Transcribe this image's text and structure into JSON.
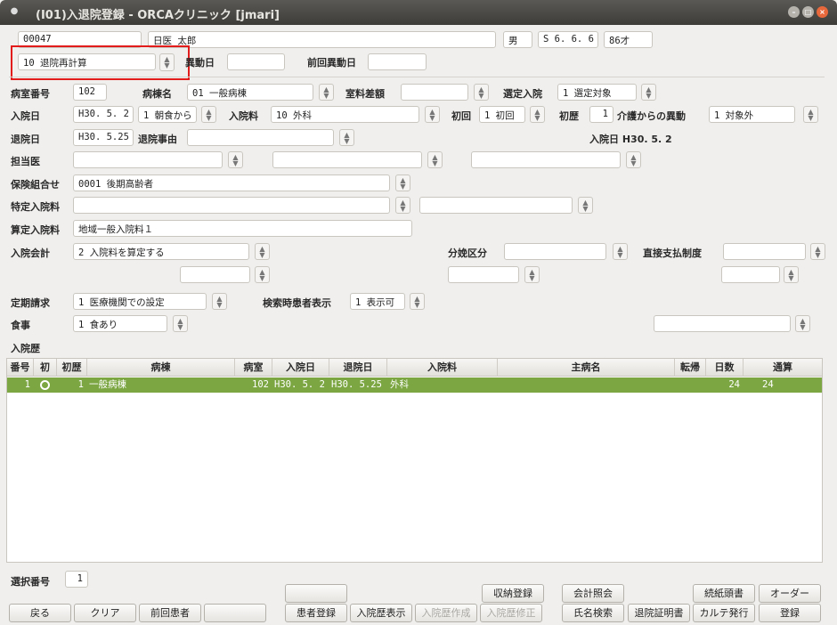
{
  "window": {
    "title": "(I01)入退院登録 - ORCAクリニック [jmari]"
  },
  "patient": {
    "id": "00047",
    "name": "日医  太郎",
    "sex": "男",
    "birthdate": "S 6. 6. 6",
    "age": "86才"
  },
  "mode_select": {
    "value": "10 退院再計算"
  },
  "labels": {
    "ido_date": "異動日",
    "prev_ido_date": "前回異動日",
    "room_no": "病室番号",
    "ward_name": "病棟名",
    "room_diff": "室料差額",
    "selected_admission": "選定入院",
    "admission_date": "入院日",
    "admission_dept": "入院料",
    "first_time": "初回",
    "first_history": "初歴",
    "care_transfer": "介護からの異動",
    "discharge_date": "退院日",
    "discharge_reason": "退院事由",
    "doctor": "担当医",
    "insurance_combo": "保険組合せ",
    "special_fee": "特定入院料",
    "calc_fee": "算定入院料",
    "admission_account": "入院会計",
    "delivery_class": "分娩区分",
    "direct_payment": "直接支払制度",
    "periodic_billing": "定期請求",
    "search_display": "検索時患者表示",
    "meal": "食事",
    "history": "入院歴",
    "select_no": "選択番号"
  },
  "fields": {
    "room_no": "102",
    "ward_name": "01 一般病棟",
    "room_diff": "",
    "selected_admission": "1 選定対象",
    "admission_date": "H30. 5. 2",
    "meal_start": "1 朝食から",
    "admission_dept": "10 外科",
    "first_time": "1 初回",
    "first_history": "1",
    "care_transfer": "1 対象外",
    "discharge_date": "H30. 5.25",
    "discharge_reason": "",
    "admission_date_info": "入院日 H30. 5. 2",
    "insurance_combo": "0001 後期高齢者",
    "calc_fee": "地域一般入院料１",
    "admission_account": "2 入院料を算定する",
    "periodic_billing": "1 医療機関での設定",
    "search_display": "1 表示可",
    "meal": "1 食あり",
    "select_no": "1"
  },
  "table": {
    "headers": [
      "番号",
      "初",
      "初歴",
      "病棟",
      "病室",
      "入院日",
      "退院日",
      "入院料",
      "主病名",
      "転帰",
      "日数",
      "通算"
    ],
    "rows": [
      {
        "no": "1",
        "first_history": "1",
        "ward": "一般病棟",
        "room": "102",
        "admission": "H30. 5. 2",
        "discharge": "H30. 5.25",
        "dept": "外科",
        "diagnosis": "",
        "outcome": "",
        "days": "24",
        "total": "24"
      }
    ]
  },
  "buttons": {
    "back": "戻る",
    "clear": "クリア",
    "prev_patient": "前回患者",
    "patient_reg": "患者登録",
    "history_display": "入院歴表示",
    "history_create": "入院歴作成",
    "history_fix": "入院歴修正",
    "receipt_reg": "収納登録",
    "account_ref": "会計照会",
    "name_search": "氏名検索",
    "admission_cert": "退院証明書",
    "continue_head": "続紙頭書",
    "order": "オーダー",
    "karte_issue": "カルテ発行",
    "register": "登録"
  },
  "colors": {
    "selected_row": "#7ba642",
    "highlight": "#e21b1b"
  }
}
